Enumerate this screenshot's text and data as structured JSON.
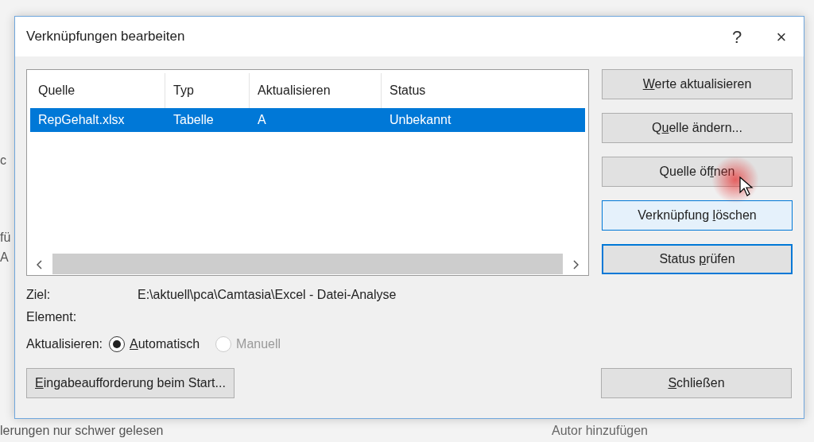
{
  "background": {
    "fragments": [
      "c",
      "fü",
      "A"
    ],
    "footer_left": "lerungen nur schwer gelesen",
    "footer_right": "Autor hinzufügen"
  },
  "window": {
    "title": "Verknüpfungen bearbeiten",
    "help": "?",
    "close": "×"
  },
  "links_table": {
    "columns": [
      "Quelle",
      "Typ",
      "Aktualisieren",
      "Status"
    ],
    "rows": [
      {
        "cells": [
          "RepGehalt.xlsx",
          "Tabelle",
          "A",
          "Unbekannt"
        ],
        "selected": true
      }
    ]
  },
  "buttons": [
    {
      "key": "W",
      "after": "erte aktualisieren",
      "hovered": false,
      "default": false
    },
    {
      "before": "Q",
      "key": "u",
      "after": "elle ändern...",
      "hovered": false,
      "default": false
    },
    {
      "before": "Quelle öf",
      "key": "f",
      "after": "nen",
      "hovered": false,
      "default": false
    },
    {
      "before": "Verknüpfung ",
      "key": "l",
      "after": "öschen",
      "hovered": true,
      "default": false
    },
    {
      "before": "Status ",
      "key": "p",
      "after": "rüfen",
      "hovered": false,
      "default": true
    }
  ],
  "details": [
    {
      "label": "Ziel:",
      "value": "E:\\aktuell\\pca\\Camtasia\\Excel - Datei-Analyse"
    },
    {
      "label": "Element:"
    }
  ],
  "update_mode": {
    "label": "Aktualisieren:",
    "options": [
      {
        "key": "A",
        "after": "utomatisch",
        "selected": true,
        "disabled": false
      },
      {
        "before": "Manuell",
        "selected": false,
        "disabled": true
      }
    ]
  },
  "bottom_buttons": [
    {
      "key": "E",
      "after": "ingabeaufforderung beim Start...",
      "hovered": false,
      "default": false
    },
    {
      "key": "S",
      "after": "chließen",
      "hovered": false,
      "default": false
    }
  ]
}
